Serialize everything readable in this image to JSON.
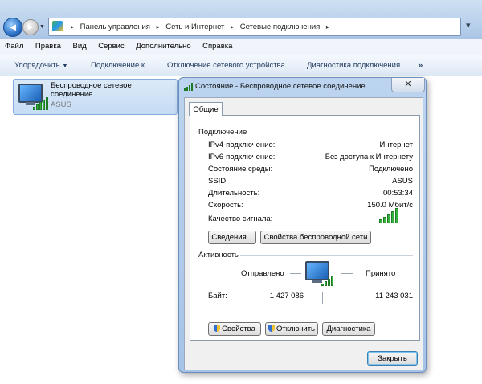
{
  "address_bar": {
    "back_symbol": "◄",
    "forward_symbol": "►",
    "recent_symbol": "▼",
    "breadcrumbs": [
      "Панель управления",
      "Сеть и Интернет",
      "Сетевые подключения"
    ],
    "separator": "▸",
    "refresh_symbol": "▾"
  },
  "menu": [
    "Файл",
    "Правка",
    "Вид",
    "Сервис",
    "Дополнительно",
    "Справка"
  ],
  "commands": {
    "organize": "Упорядочить",
    "organize_caret": "▼",
    "connect": "Подключение к",
    "disable": "Отключение сетевого устройства",
    "diagnose": "Диагностика подключения",
    "more": "»"
  },
  "connection_item": {
    "name": "Беспроводное сетевое соединение",
    "network": "ASUS"
  },
  "dialog": {
    "title": "Состояние - Беспроводное сетевое соединение",
    "close_symbol": "✕",
    "tab": "Общие",
    "connection_group": "Подключение",
    "rows": [
      {
        "label": "IPv4-подключение:",
        "value": "Интернет"
      },
      {
        "label": "IPv6-подключение:",
        "value": "Без доступа к Интернету"
      },
      {
        "label": "Состояние среды:",
        "value": "Подключено"
      },
      {
        "label": "SSID:",
        "value": "ASUS"
      },
      {
        "label": "Длительность:",
        "value": "00:53:34"
      },
      {
        "label": "Скорость:",
        "value": "150.0 Мбит/с"
      }
    ],
    "signal_label": "Качество сигнала:",
    "signal_level": 5,
    "signal_max": 5,
    "details_button": "Сведения...",
    "wireless_props_button": "Свойства беспроводной сети",
    "activity_group": "Активность",
    "sent_label": "Отправлено",
    "received_label": "Принято",
    "bytes_label": "Байт:",
    "bytes_sent": "1 427 086",
    "bytes_received": "11 243 031",
    "properties_button": "Свойства",
    "disable_button": "Отключить",
    "diagnose_button": "Диагностика",
    "close_button": "Закрыть"
  },
  "colors": {
    "signal_green": "#33b13a",
    "title_bar": "#a6c3e7"
  }
}
